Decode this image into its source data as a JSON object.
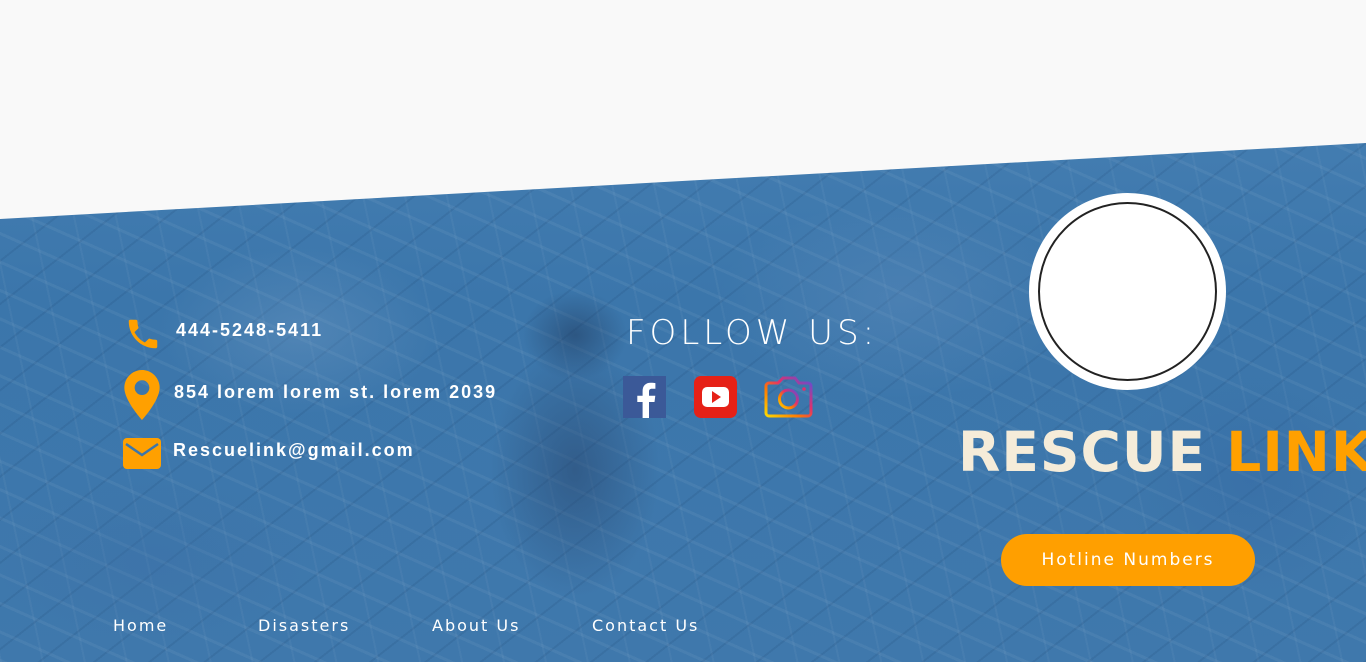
{
  "contact": {
    "phone": "444-5248-5411",
    "address": "854 lorem lorem st. lorem 2039",
    "email": "Rescuelink@gmail.com",
    "icons": [
      "phone-icon",
      "location-pin-icon",
      "mail-icon"
    ],
    "icon_color": "#ffa000"
  },
  "follow": {
    "title": "FOLLOW US:",
    "networks": [
      "facebook-icon",
      "youtube-icon",
      "instagram-icon"
    ]
  },
  "brand": {
    "word1": "RESCUE",
    "word2": "LINK",
    "word1_color": "#f5ecd9",
    "word2_color": "#ffa000"
  },
  "hotline_button": {
    "label": "Hotline Numbers",
    "color": "#ff9f00"
  },
  "nav": {
    "items": [
      "Home",
      "Disasters",
      "About Us",
      "Contact Us"
    ]
  },
  "colors": {
    "overlay": "#3b76ab",
    "page_bg": "#f9f9f9"
  }
}
